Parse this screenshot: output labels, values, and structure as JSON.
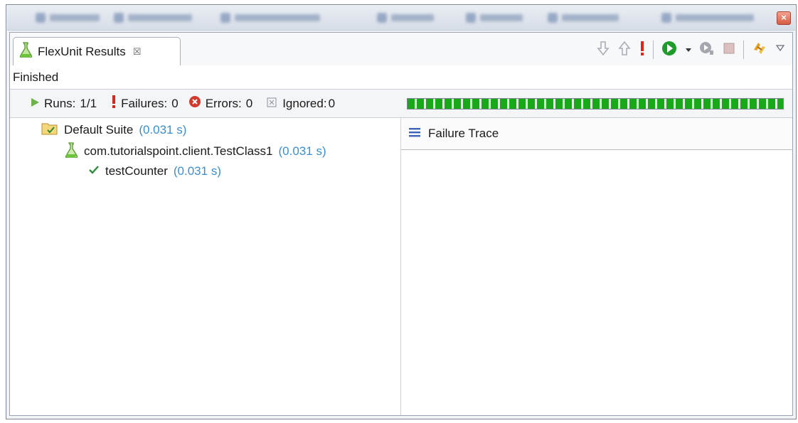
{
  "view": {
    "tab_label": "FlexUnit Results",
    "status": "Finished"
  },
  "counters": {
    "runs_label": "Runs:",
    "runs_value": "1/1",
    "failures_label": "Failures:",
    "failures_value": "0",
    "errors_label": "Errors:",
    "errors_value": "0",
    "ignored_label": "Ignored:",
    "ignored_value": "0",
    "progress_fraction": 1.0
  },
  "tree": {
    "suite": {
      "name": "Default Suite",
      "time": "(0.031 s)"
    },
    "test_class": {
      "name": "com.tutorialspoint.client.TestClass1",
      "time": "(0.031 s)"
    },
    "test_method": {
      "name": "testCounter",
      "time": "(0.031 s)"
    }
  },
  "trace": {
    "title": "Failure Trace"
  },
  "colors": {
    "success_green": "#19a81a",
    "failure_red": "#d8281e",
    "time_blue": "#3a8fd0"
  },
  "icons": [
    "flask-icon",
    "next-failure-icon",
    "previous-failure-icon",
    "failures-only-icon",
    "rerun-icon",
    "rerun-dropdown-icon",
    "rerun-failed-icon",
    "stop-icon",
    "sync-icon",
    "view-menu-icon",
    "folder-icon",
    "check-icon",
    "trace-list-icon"
  ]
}
